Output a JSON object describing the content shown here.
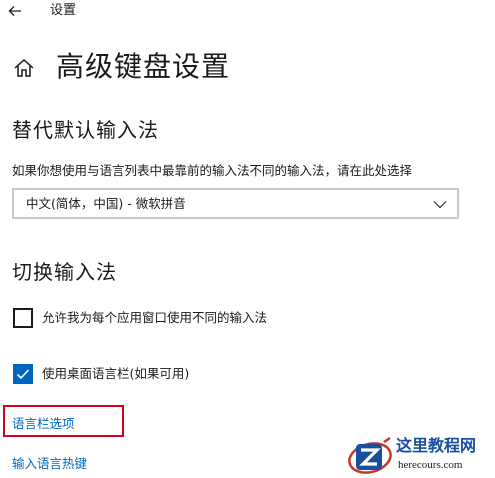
{
  "window": {
    "title": "设置"
  },
  "page": {
    "title": "高级键盘设置"
  },
  "override_input": {
    "heading": "替代默认输入法",
    "description": "如果你想使用与语言列表中最靠前的输入法不同的输入法，请在此处选择",
    "selected_value": "中文(简体，中国) - 微软拼音"
  },
  "switch_input": {
    "heading": "切换输入法",
    "options": [
      {
        "label": "允许我为每个应用窗口使用不同的输入法",
        "checked": false
      },
      {
        "label": "使用桌面语言栏(如果可用)",
        "checked": true
      }
    ]
  },
  "links": {
    "language_bar_options": "语言栏选项",
    "input_language_hotkeys": "输入语言热键"
  },
  "watermark": {
    "name": "这里教程网",
    "domain": "herecours.com"
  },
  "colors": {
    "accent": "#0067c0",
    "highlight": "#d0021b"
  },
  "icons": {
    "back": "back-arrow-icon",
    "home": "home-icon",
    "chevron": "chevron-down-icon",
    "check": "checkmark-icon"
  }
}
